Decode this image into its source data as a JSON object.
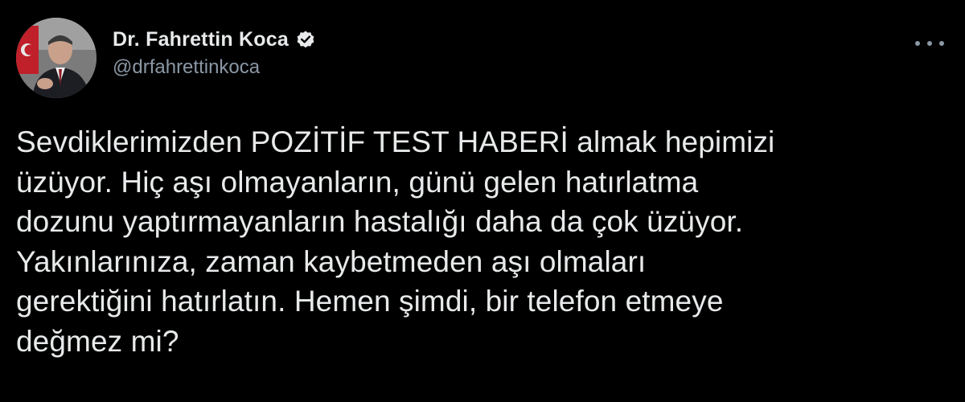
{
  "author": {
    "display_name": "Dr. Fahrettin Koca",
    "handle": "@drfahrettinkoca",
    "verified_icon": "verified-badge-icon",
    "avatar": "profile-photo"
  },
  "menu": {
    "icon": "more-options-icon"
  },
  "tweet": {
    "lines": [
      "Sevdiklerimizden POZİTİF TEST HABERİ almak hepimizi",
      "üzüyor. Hiç aşı olmayanların, günü gelen hatırlatma",
      "dozunu yaptırmayanların hastalığı daha da çok üzüyor.",
      "Yakınlarınıza, zaman kaybetmeden aşı olmaları",
      "gerektiğini hatırlatın. Hemen şimdi, bir telefon etmeye",
      "değmez mi?"
    ]
  },
  "colors": {
    "background": "#000000",
    "text_primary": "#e7e9ea",
    "text_secondary": "#8b98a5"
  }
}
